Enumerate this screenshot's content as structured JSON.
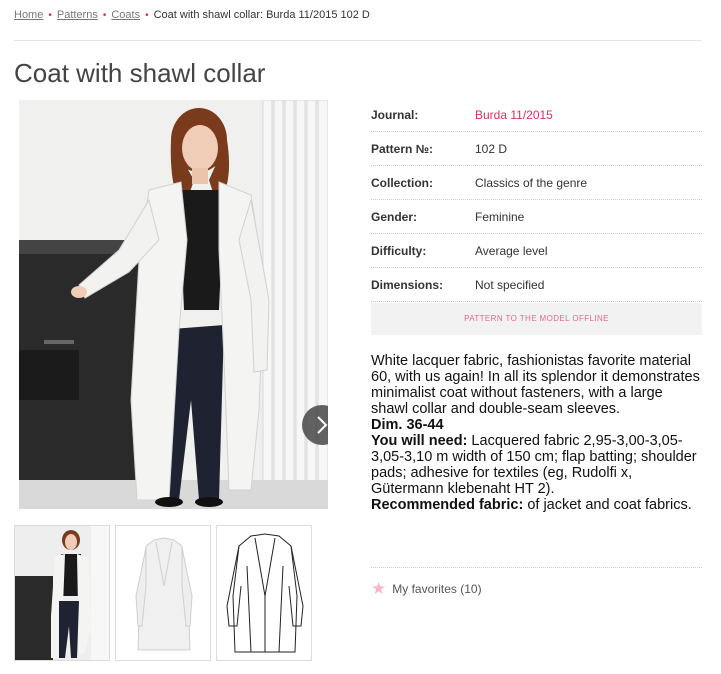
{
  "breadcrumb": {
    "home": "Home",
    "patterns": "Patterns",
    "coats": "Coats",
    "current": "Coat with shawl collar: Burda 11/2015 102 D"
  },
  "page_title": "Coat with shawl collar",
  "details": {
    "journal_label": "Journal:",
    "journal_value": "Burda 11/2015",
    "pattern_label": "Pattern №:",
    "pattern_value": "102 D",
    "collection_label": "Collection:",
    "collection_value": "Classics of the genre",
    "gender_label": "Gender:",
    "gender_value": "Feminine",
    "difficulty_label": "Difficulty:",
    "difficulty_value": "Average level",
    "dimensions_label": "Dimensions:",
    "dimensions_value": "Not specified"
  },
  "offline_button": "PATTERN TO THE MODEL OFFLINE",
  "description": {
    "intro": "White lacquer fabric, fashionistas favorite material 60, with us again! In all its splendor it demonstrates minimalist coat without fasteners, with a large shawl collar and double-seam sleeves.",
    "dim": "Dim. 36-44",
    "need_label": "You will need:",
    "need_text": " Lacquered fabric 2,95-3,00-3,05-3,05-3,10 m width of 150 cm; flap batting; shoulder pads; adhesive for textiles (eg, Rudolfi x, Gütermann klebenaht HT 2).",
    "fabric_label": "Recommended fabric:",
    "fabric_text": " of jacket and coat fabrics."
  },
  "favorites": {
    "label": "My favorites (10)",
    "icon": "star-icon"
  },
  "colors": {
    "accent": "#d9305f",
    "button_bg": "#f2f2f2"
  }
}
